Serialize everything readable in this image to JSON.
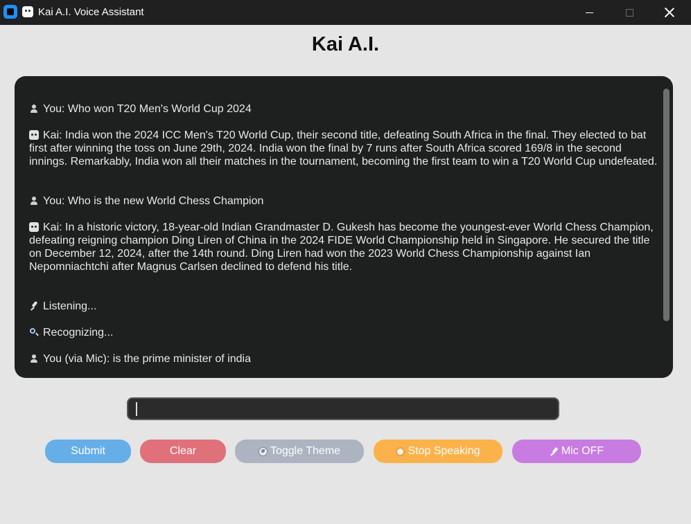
{
  "window": {
    "title": "Kai A.I. Voice Assistant"
  },
  "header": {
    "title": "Kai A.I."
  },
  "chat": {
    "messages": [
      {
        "icon": "user-icon",
        "text": "You: Who won T20 Men's World Cup 2024"
      },
      {
        "icon": "robot-icon",
        "text": "Kai: India won the 2024 ICC Men's T20 World Cup, their second title, defeating South Africa in the final. They elected to bat first after winning the toss on June 29th, 2024. India won the final by 7 runs after South Africa scored 169/8 in the second innings. Remarkably, India won all their matches in the tournament, becoming the first team to win a T20 World Cup undefeated."
      },
      {
        "icon": "user-icon",
        "text": "You: Who is the new World Chess Champion"
      },
      {
        "icon": "robot-icon",
        "text": "Kai: In a historic victory, 18-year-old Indian Grandmaster D. Gukesh has become the youngest-ever World Chess Champion, defeating reigning champion Ding Liren of China in the 2024 FIDE World Championship held in Singapore. He secured the title on December 12, 2024, after the 14th round. Ding Liren had won the 2023 World Chess Championship against Ian Nepomniachtchi after Magnus Carlsen declined to defend his title."
      },
      {
        "icon": "microphone-icon",
        "text": "Listening..."
      },
      {
        "icon": "magnifier-icon",
        "text": "Recognizing..."
      },
      {
        "icon": "user-icon",
        "text": "You (via Mic): is the prime minister of india"
      }
    ]
  },
  "input": {
    "value": "",
    "placeholder": ""
  },
  "buttons": {
    "submit": "Submit",
    "clear": "Clear",
    "toggle_theme": "Toggle Theme",
    "stop_speaking": "Stop Speaking",
    "mic": "Mic OFF"
  },
  "colors": {
    "chat_background": "#1e1f1f",
    "submit": "#65aee8",
    "clear": "#e0707a",
    "toggle_theme": "#abb4c0",
    "stop_speaking": "#fcb24a",
    "mic": "#c87be1"
  }
}
